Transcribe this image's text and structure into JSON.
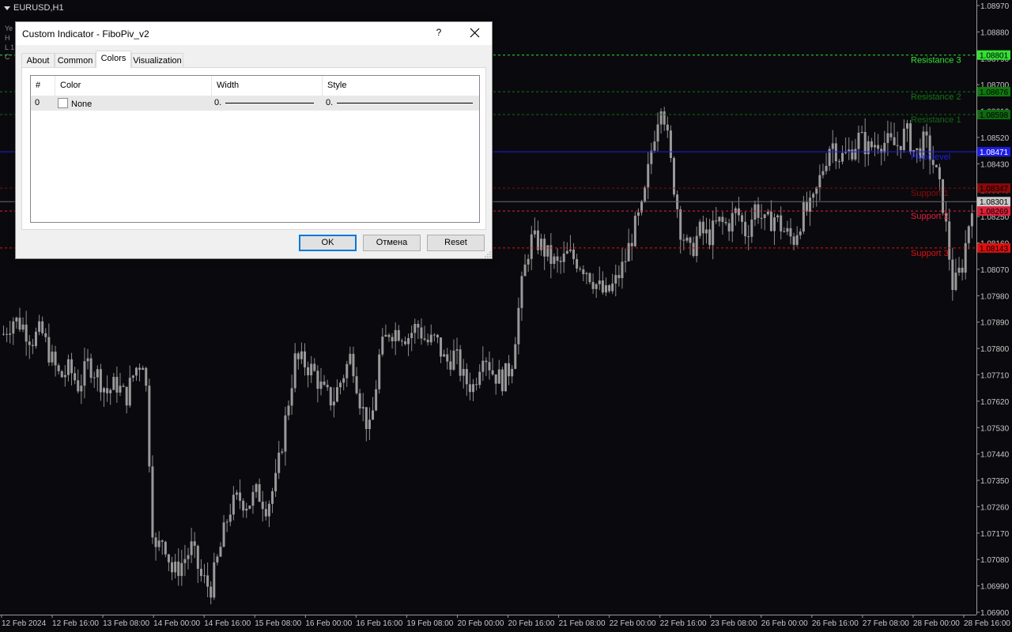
{
  "window": {
    "symbol": "EURUSD,H1",
    "side_labels": [
      "Ye",
      "H",
      "L 1",
      "C"
    ]
  },
  "chart_data": {
    "type": "candlestick",
    "price_axis": [
      "1.08970",
      "1.08880",
      "1.08790",
      "1.08700",
      "1.08610",
      "1.08520",
      "1.08430",
      "1.08340",
      "1.08250",
      "1.08160",
      "1.08070",
      "1.07980",
      "1.07890",
      "1.07800",
      "1.07710",
      "1.07620",
      "1.07530",
      "1.07440",
      "1.07350",
      "1.07260",
      "1.07170",
      "1.07080",
      "1.06990",
      "1.06900"
    ],
    "ylim": [
      1.069,
      1.0897
    ],
    "time_axis": [
      "12 Feb 2024",
      "12 Feb 16:00",
      "13 Feb 08:00",
      "14 Feb 00:00",
      "14 Feb 16:00",
      "15 Feb 08:00",
      "16 Feb 00:00",
      "16 Feb 16:00",
      "19 Feb 08:00",
      "20 Feb 00:00",
      "20 Feb 16:00",
      "21 Feb 08:00",
      "22 Feb 00:00",
      "22 Feb 16:00",
      "23 Feb 08:00",
      "26 Feb 00:00",
      "26 Feb 16:00",
      "27 Feb 08:00",
      "28 Feb 00:00",
      "28 Feb 16:00"
    ],
    "close_path": [
      1.0785,
      1.079,
      1.0788,
      1.0783,
      1.0786,
      1.0777,
      1.077,
      1.0773,
      1.0767,
      1.0775,
      1.0771,
      1.0765,
      1.0768,
      1.0763,
      1.0773,
      1.0777,
      1.0709,
      1.0716,
      1.0703,
      1.0707,
      1.0712,
      1.0702,
      1.0698,
      1.0711,
      1.0725,
      1.0729,
      1.0727,
      1.0731,
      1.0726,
      1.0735,
      1.0756,
      1.0776,
      1.0775,
      1.0772,
      1.0765,
      1.0762,
      1.077,
      1.0778,
      1.0761,
      1.0751,
      1.0778,
      1.0786,
      1.0786,
      1.0784,
      1.0788,
      1.0782,
      1.0783,
      1.0775,
      1.0778,
      1.0769,
      1.0767,
      1.078,
      1.0772,
      1.0769,
      1.0774,
      1.0799,
      1.0817,
      1.0816,
      1.0811,
      1.0808,
      1.0812,
      1.081,
      1.0807,
      1.0802,
      1.0798,
      1.0802,
      1.0809,
      1.082,
      1.0828,
      1.085,
      1.0866,
      1.0842,
      1.0821,
      1.0812,
      1.082,
      1.0818,
      1.0823,
      1.0822,
      1.0827,
      1.0819,
      1.0829,
      1.0822,
      1.0825,
      1.082,
      1.0817,
      1.0826,
      1.0828,
      1.084,
      1.0851,
      1.0845,
      1.0847,
      1.0852,
      1.0848,
      1.0851,
      1.085,
      1.0849,
      1.0854,
      1.0846,
      1.0851,
      1.0842,
      1.0828,
      1.08,
      1.0809,
      1.083
    ],
    "horizontal_levels": [
      {
        "name": "Resistance 3",
        "value": "1.08801",
        "color": "#33e033"
      },
      {
        "name": "Resistance 2",
        "value": "1.08676",
        "color": "#0f7a0f"
      },
      {
        "name": "Resistance 1",
        "value": "1.08598",
        "color": "#0f6a0f"
      },
      {
        "name": "Pivot level",
        "value": "1.08471",
        "color": "#1e1ee6"
      },
      {
        "name": "Support 1",
        "value": "1.08347",
        "color": "#8a0a0a"
      },
      {
        "name": "Support 2",
        "value": "1.08269",
        "color": "#e0203a"
      },
      {
        "name": "Support 3",
        "value": "1.08143",
        "color": "#e01010"
      }
    ],
    "current_price": "1.08301"
  },
  "dialog": {
    "title": "Custom Indicator - FiboPiv_v2",
    "help_label": "?",
    "tabs": [
      "About",
      "Common",
      "Colors",
      "Visualization"
    ],
    "active_tab": "Colors",
    "table": {
      "headers": [
        "#",
        "Color",
        "Width",
        "Style"
      ],
      "rows": [
        {
          "index": "0",
          "color": "None",
          "width": "0.",
          "style": "0."
        }
      ]
    },
    "buttons": {
      "ok": "OK",
      "cancel": "Отмена",
      "reset": "Reset"
    }
  }
}
